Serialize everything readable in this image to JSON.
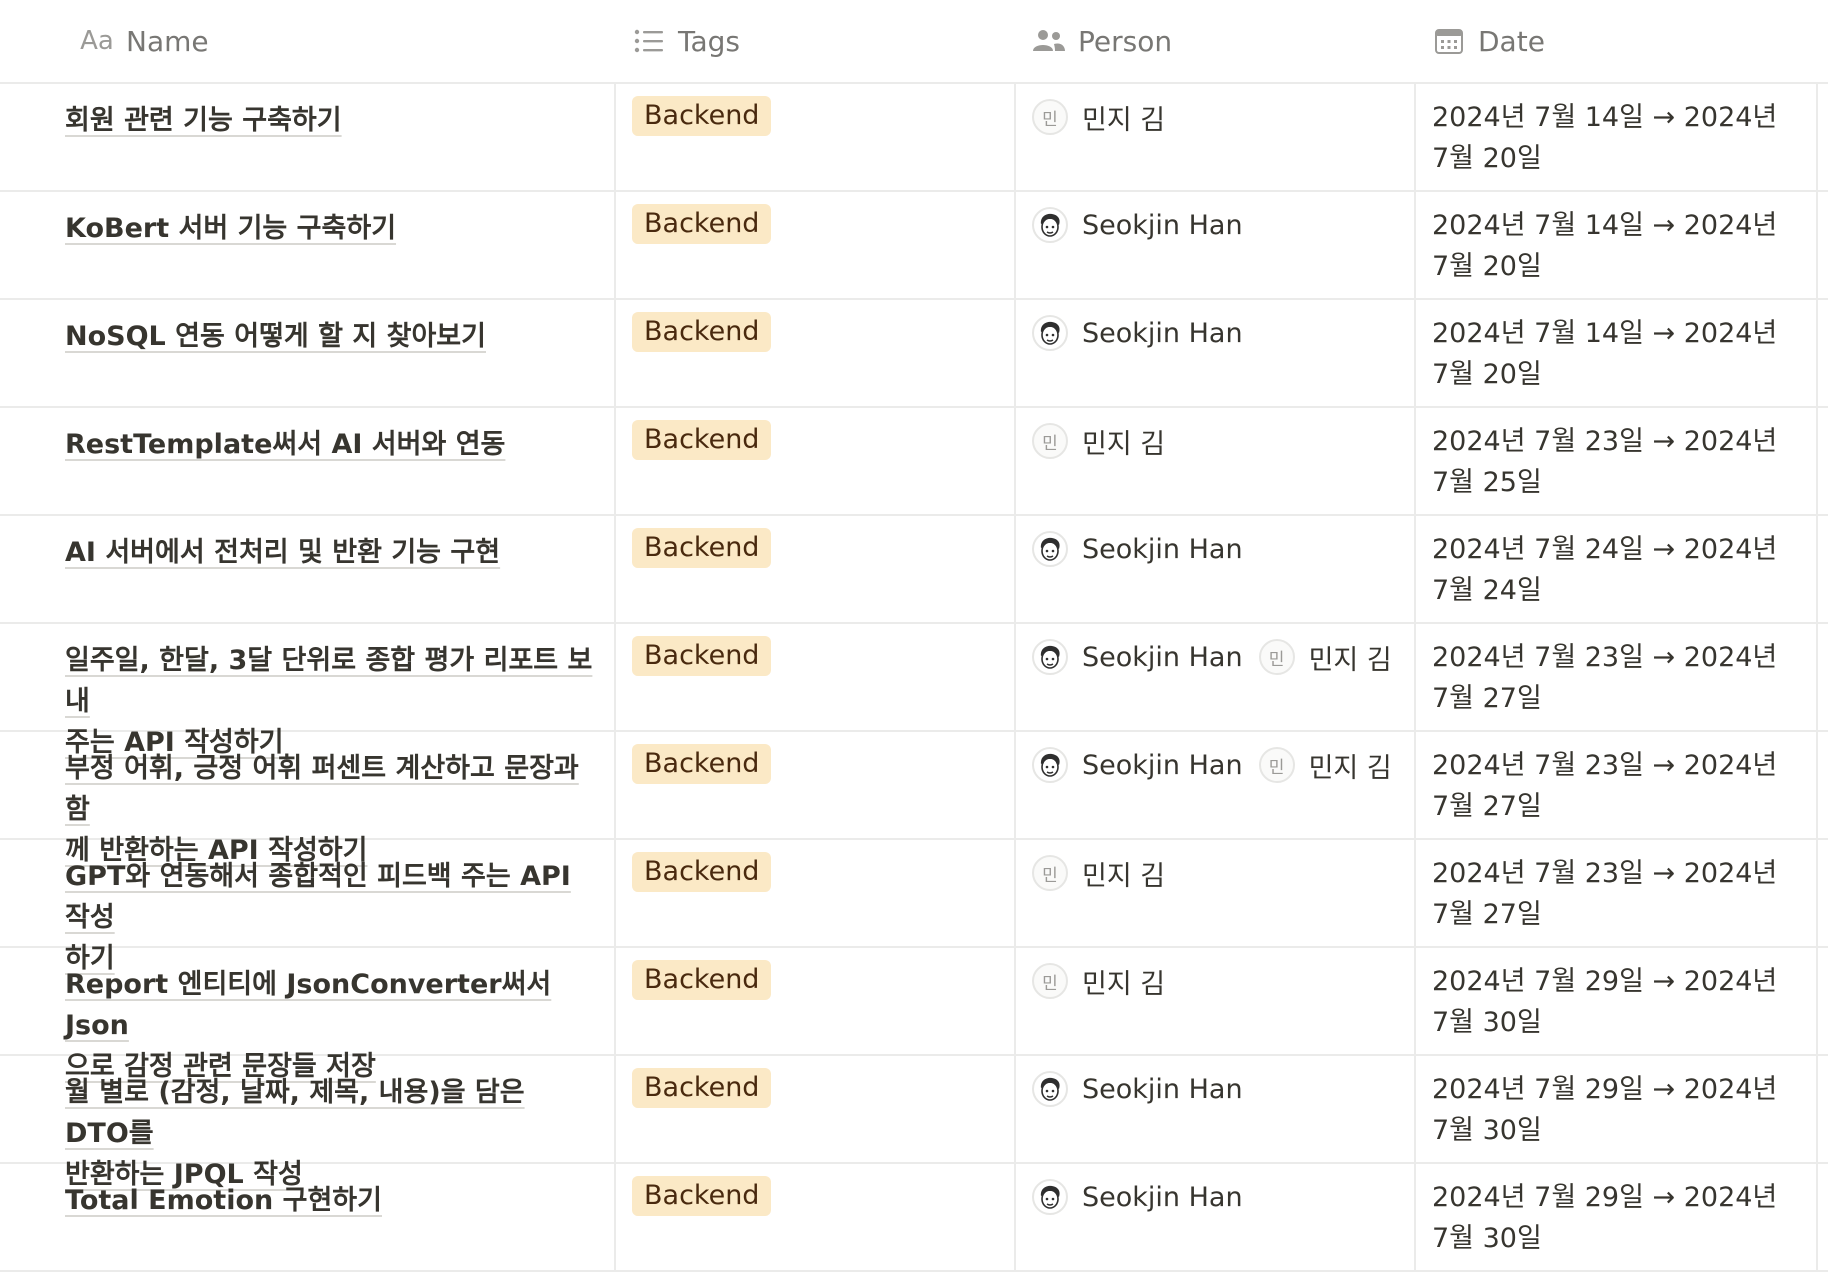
{
  "columns": [
    {
      "key": "name",
      "label": "Name",
      "icon": "text-aa-icon"
    },
    {
      "key": "tags",
      "label": "Tags",
      "icon": "list-icon"
    },
    {
      "key": "person",
      "label": "Person",
      "icon": "people-icon"
    },
    {
      "key": "date",
      "label": "Date",
      "icon": "calendar-icon"
    }
  ],
  "header": {
    "name_icon_text": "Aa"
  },
  "colors": {
    "tag_bg": "#fbe9c6",
    "tag_text": "#49290e",
    "border": "#ebebea",
    "header_text": "#787774"
  },
  "people": {
    "minji": {
      "name": "민지 김",
      "avatar": "initial",
      "initial": "민"
    },
    "seokjin": {
      "name": "Seokjin Han",
      "avatar": "face-avatar-icon"
    }
  },
  "rows": [
    {
      "title": "회원 관련 기능 구축하기",
      "tag": "Backend",
      "persons": [
        {
          "name": "민지 김",
          "initial": "민"
        }
      ],
      "date_line1": "2024년 7월 14일 → 2024년",
      "date_line2": "7월 20일"
    },
    {
      "title": "KoBert 서버 기능 구축하기",
      "tag": "Backend",
      "persons": [
        {
          "name": "Seokjin Han",
          "initial": ""
        }
      ],
      "date_line1": "2024년 7월 14일 → 2024년",
      "date_line2": "7월 20일"
    },
    {
      "title": "NoSQL 연동 어떻게 할 지 찾아보기",
      "tag": "Backend",
      "persons": [
        {
          "name": "Seokjin Han",
          "initial": ""
        }
      ],
      "date_line1": "2024년 7월 14일 → 2024년",
      "date_line2": "7월 20일"
    },
    {
      "title": "RestTemplate써서 AI 서버와 연동",
      "tag": "Backend",
      "persons": [
        {
          "name": "민지 김",
          "initial": "민"
        }
      ],
      "date_line1": "2024년 7월 23일 → 2024년",
      "date_line2": "7월 25일"
    },
    {
      "title": "AI 서버에서 전처리 및 반환 기능 구현",
      "tag": "Backend",
      "persons": [
        {
          "name": "Seokjin Han",
          "initial": ""
        }
      ],
      "date_line1": "2024년 7월 24일 → 2024년",
      "date_line2": "7월 24일"
    },
    {
      "title": "일주일, 한달, 3달 단위로 종합 평가 리포트 보내",
      "title_line2": "주는 API 작성하기",
      "tag": "Backend",
      "persons": [
        {
          "name": "Seokjin Han",
          "initial": ""
        },
        {
          "name": "민지 김",
          "initial": "민"
        }
      ],
      "date_line1": "2024년 7월 23일 → 2024년",
      "date_line2": "7월 27일"
    },
    {
      "title": "부정 어휘, 긍정 어휘 퍼센트 계산하고 문장과 함",
      "title_line2": "께 반환하는 API 작성하기",
      "tag": "Backend",
      "persons": [
        {
          "name": "Seokjin Han",
          "initial": ""
        },
        {
          "name": "민지 김",
          "initial": "민"
        }
      ],
      "date_line1": "2024년 7월 23일 → 2024년",
      "date_line2": "7월 27일"
    },
    {
      "title": "GPT와 연동해서 종합적인 피드백 주는 API 작성",
      "title_line2": "하기",
      "tag": "Backend",
      "persons": [
        {
          "name": "민지 김",
          "initial": "민"
        }
      ],
      "date_line1": "2024년 7월 23일 → 2024년",
      "date_line2": "7월 27일"
    },
    {
      "title": "Report 엔티티에 JsonConverter써서 Json",
      "title_line2": "으로 감정 관련 문장들 저장",
      "tag": "Backend",
      "persons": [
        {
          "name": "민지 김",
          "initial": "민"
        }
      ],
      "date_line1": "2024년 7월 29일 → 2024년",
      "date_line2": "7월 30일"
    },
    {
      "title": "월 별로 (감정, 날짜, 제목, 내용)을 담은 DTO를",
      "title_line2": "반환하는 JPQL 작성",
      "tag": "Backend",
      "persons": [
        {
          "name": "Seokjin Han",
          "initial": ""
        }
      ],
      "date_line1": "2024년 7월 29일 → 2024년",
      "date_line2": "7월 30일"
    },
    {
      "title": "Total Emotion 구현하기",
      "tag": "Backend",
      "persons": [
        {
          "name": "Seokjin Han",
          "initial": ""
        }
      ],
      "date_line1": "2024년 7월 29일 → 2024년",
      "date_line2": "7월 30일"
    }
  ]
}
